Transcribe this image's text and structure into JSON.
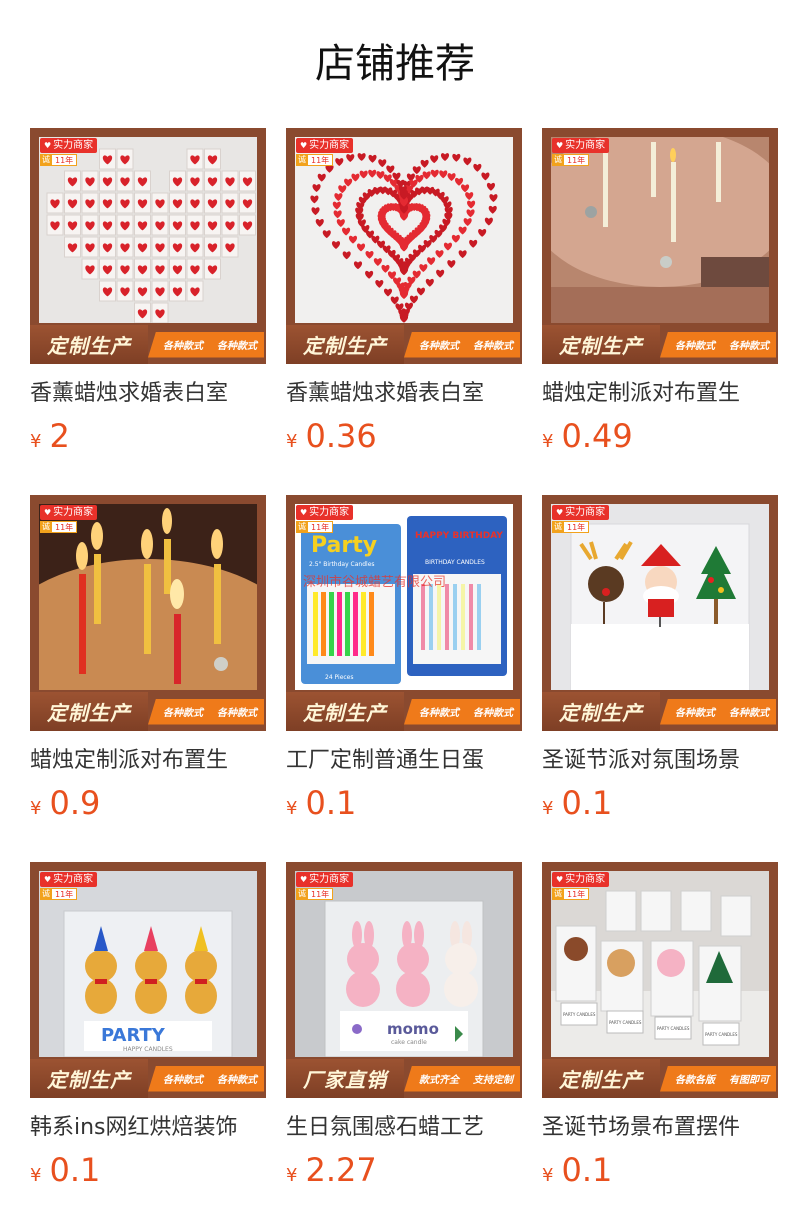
{
  "section": {
    "title": "店铺推荐"
  },
  "badges": {
    "strength": "实力商家",
    "cheng": "诚",
    "years": "11年"
  },
  "products": [
    {
      "title": "香薰蜡烛求婚表白室",
      "currency": "¥",
      "price": "2",
      "banner": {
        "main": "定制生产",
        "sub1": "各种款式",
        "sub2": "各种款式"
      },
      "scene": "hearts-grid"
    },
    {
      "title": "香薰蜡烛求婚表白室",
      "currency": "¥",
      "price": "0.36",
      "banner": {
        "main": "定制生产",
        "sub1": "各种款式",
        "sub2": "各种款式"
      },
      "scene": "heart-shape"
    },
    {
      "title": "蜡烛定制派对布置生",
      "currency": "¥",
      "price": "0.49",
      "banner": {
        "main": "定制生产",
        "sub1": "各种款式",
        "sub2": "各种款式"
      },
      "scene": "cake-top"
    },
    {
      "title": "蜡烛定制派对布置生",
      "currency": "¥",
      "price": "0.9",
      "banner": {
        "main": "定制生产",
        "sub1": "各种款式",
        "sub2": "各种款式"
      },
      "scene": "lit-candles"
    },
    {
      "title": "工厂定制普通生日蛋",
      "currency": "¥",
      "price": "0.1",
      "banner": {
        "main": "定制生产",
        "sub1": "各种款式",
        "sub2": "各种款式"
      },
      "scene": "candle-packs",
      "packs": {
        "left_title": "Party",
        "left_sub": "2.5\" Birthday Candles",
        "left_foot": "24 Pieces",
        "right_title": "HAPPY BIRTHDAY",
        "right_sub": "BIRTHDAY CANDLES",
        "watermark": "深圳市谷城蜡艺有限公司"
      }
    },
    {
      "title": "圣诞节派对氛围场景",
      "currency": "¥",
      "price": "0.1",
      "banner": {
        "main": "定制生产",
        "sub1": "各种款式",
        "sub2": "各种款式"
      },
      "scene": "xmas-trio"
    },
    {
      "title": "韩系ins网红烘焙装饰",
      "currency": "¥",
      "price": "0.1",
      "banner": {
        "main": "定制生产",
        "sub1": "各种款式",
        "sub2": "各种款式"
      },
      "scene": "party-bears",
      "card_text": {
        "title": "PARTY",
        "sub": "HAPPY CANDLES"
      }
    },
    {
      "title": "生日氛围感石蜡工艺",
      "currency": "¥",
      "price": "2.27",
      "banner": {
        "main": "厂家直销",
        "sub1": "款式齐全",
        "sub2": "支持定制"
      },
      "scene": "momo-bunnies",
      "card_text": {
        "title": "momo",
        "sub": "cake candle"
      }
    },
    {
      "title": "圣诞节场景布置摆件",
      "currency": "¥",
      "price": "0.1",
      "banner": {
        "main": "定制生产",
        "sub1": "各款各版",
        "sub2": "有图即可"
      },
      "scene": "shelf-minis",
      "card_text": {
        "label": "PARTY CANDLES"
      }
    }
  ],
  "colors": {
    "price": "#e8501e",
    "frame": "#8a4a2f",
    "banner_accent": "#ef7a1a",
    "badge_red": "#e8312a"
  }
}
